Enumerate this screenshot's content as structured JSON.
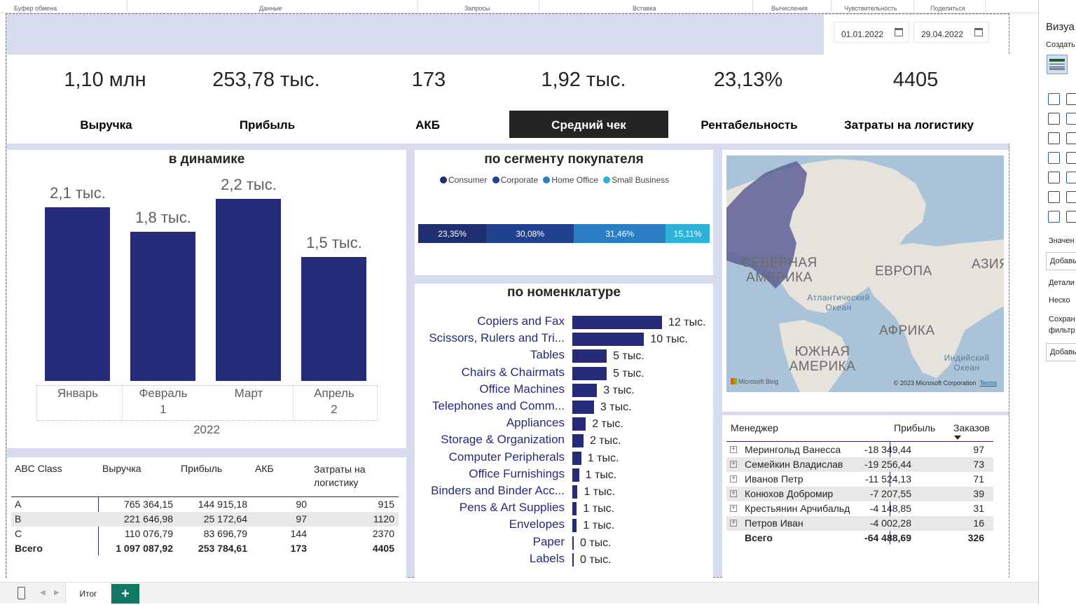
{
  "ribbon": {
    "groups": [
      "Буфер обмена",
      "Данные",
      "Запросы",
      "Вставка",
      "Вычисления",
      "Чувствительность",
      "Поделиться"
    ]
  },
  "filters": {
    "date_from": "01.01.2022",
    "date_to": "29.04.2022"
  },
  "kpis": [
    {
      "value": "1,10 млн",
      "label": "Выручка"
    },
    {
      "value": "253,78 тыс.",
      "label": "Прибыль"
    },
    {
      "value": "173",
      "label": "АКБ"
    },
    {
      "value": "1,92 тыс.",
      "label": "Средний чек"
    },
    {
      "value": "23,13%",
      "label": "Рентабельность"
    },
    {
      "value": "4405",
      "label": "Затраты на логистику"
    }
  ],
  "active_tab": "Средний чек",
  "dynamics": {
    "title": "в динамике",
    "year": "2022",
    "bars": [
      {
        "month": "Январь",
        "label": "2,1 тыс.",
        "value": 2.1,
        "sub": ""
      },
      {
        "month": "Февраль",
        "label": "1,8 тыс.",
        "value": 1.8,
        "sub": "1"
      },
      {
        "month": "Март",
        "label": "2,2 тыс.",
        "value": 2.2,
        "sub": ""
      },
      {
        "month": "Апрель",
        "label": "1,5 тыс.",
        "value": 1.5,
        "sub": "2"
      }
    ]
  },
  "segment": {
    "title": "по сегменту покупателя",
    "legend": [
      {
        "name": "Consumer",
        "color": "#1f2e6e"
      },
      {
        "name": "Corporate",
        "color": "#22418f"
      },
      {
        "name": "Home Office",
        "color": "#2a7fc4"
      },
      {
        "name": "Small Business",
        "color": "#2fb2d9"
      }
    ],
    "parts": [
      {
        "label": "23,35%",
        "value": 23.35,
        "color": "#1f2e6e"
      },
      {
        "label": "30,08%",
        "value": 30.08,
        "color": "#22418f"
      },
      {
        "label": "31,46%",
        "value": 31.46,
        "color": "#2a7fc4"
      },
      {
        "label": "15,11%",
        "value": 15.11,
        "color": "#2fb2d9"
      }
    ]
  },
  "nomenclature": {
    "title": "по номенклатуре",
    "items": [
      {
        "name": "Copiers and Fax",
        "label": "12 тыс.",
        "value": 12
      },
      {
        "name": "Scissors, Rulers and Tri...",
        "label": "10 тыс.",
        "value": 9.6
      },
      {
        "name": "Tables",
        "label": "5 тыс.",
        "value": 4.6
      },
      {
        "name": "Chairs & Chairmats",
        "label": "5 тыс.",
        "value": 4.6
      },
      {
        "name": "Office Machines",
        "label": "3 тыс.",
        "value": 3.3
      },
      {
        "name": "Telephones and Comm...",
        "label": "3 тыс.",
        "value": 2.9
      },
      {
        "name": "Appliances",
        "label": "2 тыс.",
        "value": 1.8
      },
      {
        "name": "Storage & Organization",
        "label": "2 тыс.",
        "value": 1.5
      },
      {
        "name": "Computer Peripherals",
        "label": "1 тыс.",
        "value": 1.2
      },
      {
        "name": "Office Furnishings",
        "label": "1 тыс.",
        "value": 0.9
      },
      {
        "name": "Binders and Binder Acc...",
        "label": "1 тыс.",
        "value": 0.7
      },
      {
        "name": "Pens & Art Supplies",
        "label": "1 тыс.",
        "value": 0.6
      },
      {
        "name": "Envelopes",
        "label": "1 тыс.",
        "value": 0.6
      },
      {
        "name": "Paper",
        "label": "0 тыс.",
        "value": 0.15
      },
      {
        "name": "Labels",
        "label": "0 тыс.",
        "value": 0.1
      }
    ]
  },
  "map": {
    "labels": [
      "СЕВЕРНАЯ АМЕРИКА",
      "ЕВРОПА",
      "АЗИЯ",
      "Атлантический Океан",
      "АФРИКА",
      "ЮЖНАЯ АМЕРИКА",
      "Индийский Океан"
    ],
    "brand": "Microsoft Bing",
    "copyright": "© 2023 Microsoft Corporation",
    "terms": "Terms"
  },
  "abc_table": {
    "headers": [
      "ABC Class",
      "Выручка",
      "Прибыль",
      "АКБ",
      "Затраты на логистику"
    ],
    "rows": [
      [
        "A",
        "765 364,15",
        "144 915,18",
        "90",
        "915"
      ],
      [
        "B",
        "221 646,98",
        "25 172,64",
        "97",
        "1120"
      ],
      [
        "C",
        "110 076,79",
        "83 696,79",
        "144",
        "2370"
      ]
    ],
    "total": [
      "Всего",
      "1 097 087,92",
      "253 784,61",
      "173",
      "4405"
    ]
  },
  "managers": {
    "headers": [
      "Менеджер",
      "Прибыль",
      "Заказов"
    ],
    "rows": [
      [
        "Мерингольд Ванесса",
        "-18 349,44",
        "97"
      ],
      [
        "Семейкин Владислав",
        "-19 256,44",
        "73"
      ],
      [
        "Иванов Петр",
        "-11 524,13",
        "71"
      ],
      [
        "Конюхов Добромир",
        "-7 207,55",
        "39"
      ],
      [
        "Крестьянин Арчибальд",
        "-4 148,85",
        "31"
      ],
      [
        "Петров Иван",
        "-4 002,28",
        "16"
      ]
    ],
    "total": [
      "Всего",
      "-64 488,69",
      "326"
    ]
  },
  "sheet_tab": "Итог",
  "side_panel": {
    "title": "Визуа",
    "create": "Создать",
    "values": "Значен",
    "add1": "Добавь",
    "details": "Детали",
    "some": "Неско",
    "save": "Сохран",
    "filter": "фильтр",
    "add2": "Добавь"
  }
}
